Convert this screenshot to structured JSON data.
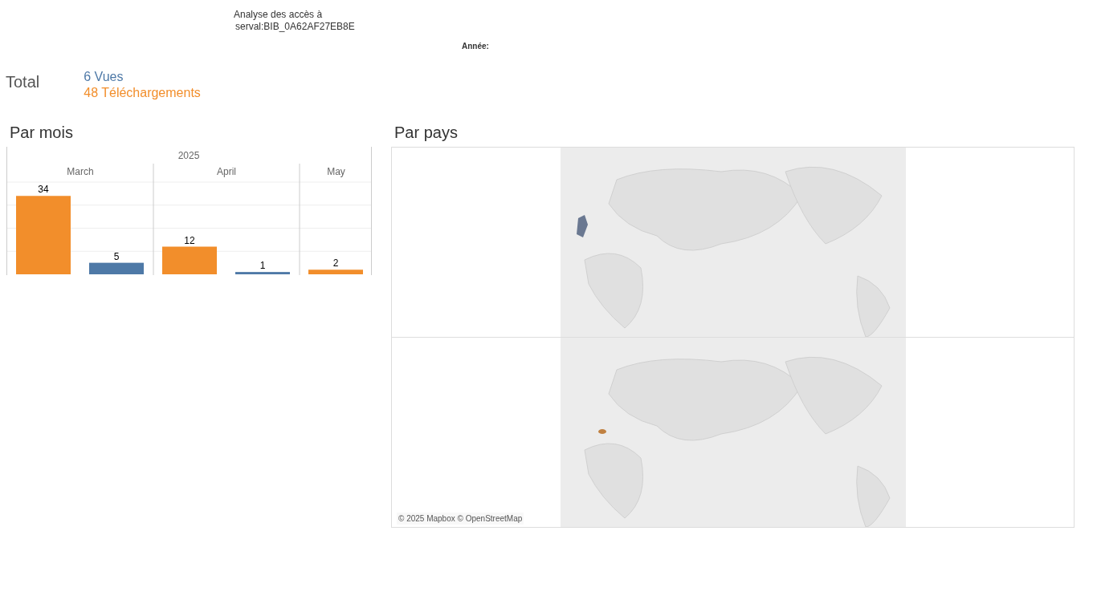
{
  "title_lines": [
    "Analyse des accès à",
    "serval:BIB_0A62AF27EB8E"
  ],
  "filter": {
    "label": "Année:"
  },
  "totals": {
    "label": "Total",
    "items": [
      {
        "text": "6 Vues",
        "color": "#4e79a7"
      },
      {
        "text": "48 Téléchargements",
        "color": "#f28e2b"
      }
    ]
  },
  "monthly": {
    "title": "Par mois",
    "year": "2025",
    "chart_data": {
      "type": "bar",
      "categories": [
        "March",
        "April",
        "May"
      ],
      "ylim": [
        0,
        40
      ],
      "data_labels": true,
      "series": [
        {
          "color": "#f28e2b",
          "values": [
            34,
            12,
            2
          ]
        },
        {
          "color": "#4e79a7",
          "values": [
            5,
            1,
            null
          ]
        }
      ]
    }
  },
  "countries": {
    "title": "Par pays",
    "attribution": "© 2025 Mapbox © OpenStreetMap"
  }
}
